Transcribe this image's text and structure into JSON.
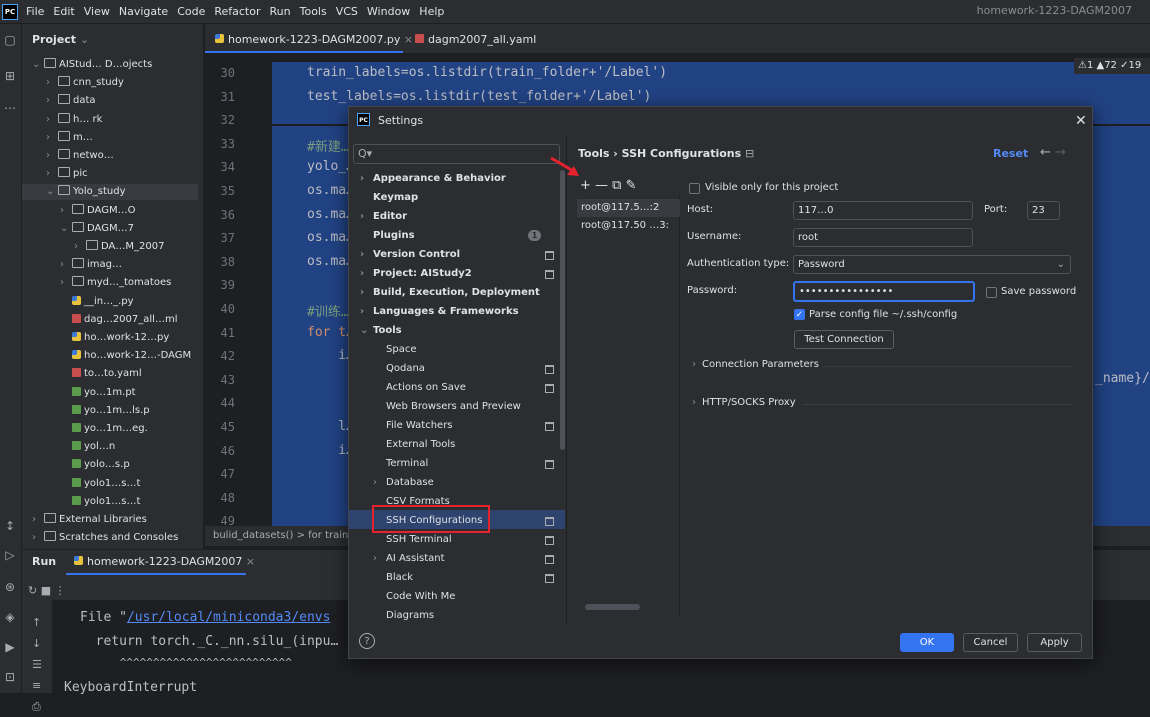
{
  "menubar": {
    "items": [
      "File",
      "Edit",
      "View",
      "Navigate",
      "Code",
      "Refactor",
      "Run",
      "Tools",
      "VCS",
      "Window",
      "Help"
    ],
    "project": "homework-1223-DAGM2007"
  },
  "project_panel": {
    "title": "Project",
    "items": [
      {
        "label": "AIStud… D…ojects",
        "type": "folder",
        "indent": 0,
        "arrow": "⌄"
      },
      {
        "label": "cnn_study",
        "type": "folder",
        "indent": 1,
        "arrow": "›"
      },
      {
        "label": "data",
        "type": "folder",
        "indent": 1,
        "arrow": "›"
      },
      {
        "label": "h… rk",
        "type": "folder",
        "indent": 1,
        "arrow": "›"
      },
      {
        "label": "m…",
        "type": "folder",
        "indent": 1,
        "arrow": "›"
      },
      {
        "label": "netwo…",
        "type": "folder",
        "indent": 1,
        "arrow": "›"
      },
      {
        "label": "pic",
        "type": "folder",
        "indent": 1,
        "arrow": "›"
      },
      {
        "label": "Yolo_study",
        "type": "folder",
        "indent": 1,
        "arrow": "⌄"
      },
      {
        "label": "DAGM…O",
        "type": "folder",
        "indent": 2,
        "arrow": "›"
      },
      {
        "label": "DAGM…7",
        "type": "folder",
        "indent": 2,
        "arrow": "⌄"
      },
      {
        "label": "DA…M_2007",
        "type": "folder",
        "indent": 3,
        "arrow": "›"
      },
      {
        "label": "imag…",
        "type": "folder",
        "indent": 2,
        "arrow": "›"
      },
      {
        "label": "myd…_tomatoes",
        "type": "folder",
        "indent": 2,
        "arrow": "›"
      },
      {
        "label": "__in…_.py",
        "type": "py",
        "indent": 2,
        "arrow": ""
      },
      {
        "label": "dag…2007_all…ml",
        "type": "yaml",
        "indent": 2,
        "arrow": ""
      },
      {
        "label": "ho…work-12…py",
        "type": "py",
        "indent": 2,
        "arrow": ""
      },
      {
        "label": "ho…work-12…-DAGM",
        "type": "py",
        "indent": 2,
        "arrow": ""
      },
      {
        "label": "to…to.yaml",
        "type": "yaml",
        "indent": 2,
        "arrow": ""
      },
      {
        "label": "yo…1m.pt",
        "type": "pt",
        "indent": 2,
        "arrow": ""
      },
      {
        "label": "yo…1m…ls.p",
        "type": "pt",
        "indent": 2,
        "arrow": ""
      },
      {
        "label": "yo…1m…eg.",
        "type": "pt",
        "indent": 2,
        "arrow": ""
      },
      {
        "label": "yol…n",
        "type": "pt",
        "indent": 2,
        "arrow": ""
      },
      {
        "label": "yolo…s.p",
        "type": "pt",
        "indent": 2,
        "arrow": ""
      },
      {
        "label": "yolo1…s…t",
        "type": "pt",
        "indent": 2,
        "arrow": ""
      },
      {
        "label": "yolo1…s…t",
        "type": "pt",
        "indent": 2,
        "arrow": ""
      },
      {
        "label": "External Libraries",
        "type": "lib",
        "indent": 0,
        "arrow": "›"
      },
      {
        "label": "Scratches and Consoles",
        "type": "lib",
        "indent": 0,
        "arrow": "›"
      }
    ]
  },
  "tabs": [
    {
      "label": "homework-1223-DAGM2007.py",
      "close": "×"
    },
    {
      "label": "dagm2007_all.yaml",
      "close": ""
    }
  ],
  "editor": {
    "line_numbers": [
      "30",
      "31",
      "32",
      "33",
      "34",
      "35",
      "36",
      "37",
      "38",
      "39",
      "40",
      "41",
      "42",
      "43",
      "44",
      "45",
      "46",
      "47",
      "48",
      "49"
    ],
    "lines": [
      "train_labels=os.listdir(train_folder+'/Label')",
      "test_labels=os.listdir(test_folder+'/Label')",
      "",
      "#新建…",
      "yolo_…",
      "os.ma…",
      "os.ma…",
      "os.ma…",
      "os.ma…",
      "",
      "#训练…",
      "for t…",
      "    i…",
      "",
      "",
      "    l…",
      "    i…",
      "",
      "",
      ""
    ],
    "right_fragment": "_name}/",
    "warnings": "⚠1 ▲72 ✓19"
  },
  "breadcrumbs": "bulid_datasets()   >   for train_…",
  "run_panel": {
    "title": "Run",
    "tab": "homework-1223-DAGM2007",
    "console": [
      "File \"/usr/local/miniconda3/envs…",
      "  return torch._C._nn.silu_(inpu…",
      "      ^^^^^^^^^^^^^^^^^^^^^^^^^^",
      "KeyboardInterrupt"
    ],
    "link_text": "/usr/local/miniconda3/envs"
  },
  "dialog": {
    "title": "Settings",
    "search_placeholder": "Q▾",
    "breadcrumb": "Tools  ›  SSH Configurations",
    "reset": "Reset",
    "nav": [
      {
        "label": "Appearance & Behavior",
        "bold": true,
        "arrow": "›",
        "level": 0,
        "mark": false
      },
      {
        "label": "Keymap",
        "bold": true,
        "arrow": "",
        "level": 0,
        "mark": false
      },
      {
        "label": "Editor",
        "bold": true,
        "arrow": "›",
        "level": 0,
        "mark": false
      },
      {
        "label": "Plugins",
        "bold": true,
        "arrow": "",
        "level": 0,
        "mark": false,
        "badge": "1"
      },
      {
        "label": "Version Control",
        "bold": true,
        "arrow": "›",
        "level": 0,
        "mark": true
      },
      {
        "label": "Project: AIStudy2",
        "bold": true,
        "arrow": "›",
        "level": 0,
        "mark": true
      },
      {
        "label": "Build, Execution, Deployment",
        "bold": true,
        "arrow": "›",
        "level": 0,
        "mark": false
      },
      {
        "label": "Languages & Frameworks",
        "bold": true,
        "arrow": "›",
        "level": 0,
        "mark": false
      },
      {
        "label": "Tools",
        "bold": true,
        "arrow": "⌄",
        "level": 0,
        "mark": false
      },
      {
        "label": "Space",
        "bold": false,
        "arrow": "",
        "level": 1,
        "mark": false
      },
      {
        "label": "Qodana",
        "bold": false,
        "arrow": "",
        "level": 1,
        "mark": true
      },
      {
        "label": "Actions on Save",
        "bold": false,
        "arrow": "",
        "level": 1,
        "mark": true
      },
      {
        "label": "Web Browsers and Preview",
        "bold": false,
        "arrow": "",
        "level": 1,
        "mark": false
      },
      {
        "label": "File Watchers",
        "bold": false,
        "arrow": "",
        "level": 1,
        "mark": true
      },
      {
        "label": "External Tools",
        "bold": false,
        "arrow": "",
        "level": 1,
        "mark": false
      },
      {
        "label": "Terminal",
        "bold": false,
        "arrow": "",
        "level": 1,
        "mark": true
      },
      {
        "label": "Database",
        "bold": false,
        "arrow": "›",
        "level": 1,
        "mark": false
      },
      {
        "label": "CSV Formats",
        "bold": false,
        "arrow": "",
        "level": 1,
        "mark": false
      },
      {
        "label": "SSH Configurations",
        "bold": false,
        "arrow": "",
        "level": 1,
        "mark": true
      },
      {
        "label": "SSH Terminal",
        "bold": false,
        "arrow": "",
        "level": 1,
        "mark": true
      },
      {
        "label": "AI Assistant",
        "bold": false,
        "arrow": "›",
        "level": 1,
        "mark": true
      },
      {
        "label": "Black",
        "bold": false,
        "arrow": "",
        "level": 1,
        "mark": true
      },
      {
        "label": "Code With Me",
        "bold": false,
        "arrow": "",
        "level": 1,
        "mark": false
      },
      {
        "label": "Diagrams",
        "bold": false,
        "arrow": "",
        "level": 1,
        "mark": false
      }
    ],
    "toolbar": "+  —  ⧉  ✎",
    "ssh_list": [
      "root@117.5…:2",
      "root@117.50 …3:"
    ],
    "visible_only": "Visible only for this project",
    "host_label": "Host:",
    "host_value": "117…0",
    "port_label": "Port:",
    "port_value": "23",
    "username_label": "Username:",
    "username_value": "root",
    "auth_label": "Authentication type:",
    "auth_value": "Password",
    "password_label": "Password:",
    "password_value": "••••••••••••••••",
    "save_password": "Save password",
    "parse_config": "Parse config file ~/.ssh/config",
    "test_connection": "Test Connection",
    "connection_params": "Connection Parameters",
    "proxy": "HTTP/SOCKS Proxy",
    "ok": "OK",
    "cancel": "Cancel",
    "apply": "Apply",
    "help": "?"
  },
  "colors": {
    "accent": "#3574f0",
    "highlight": "#e5222e",
    "background": "#2b2d30"
  }
}
